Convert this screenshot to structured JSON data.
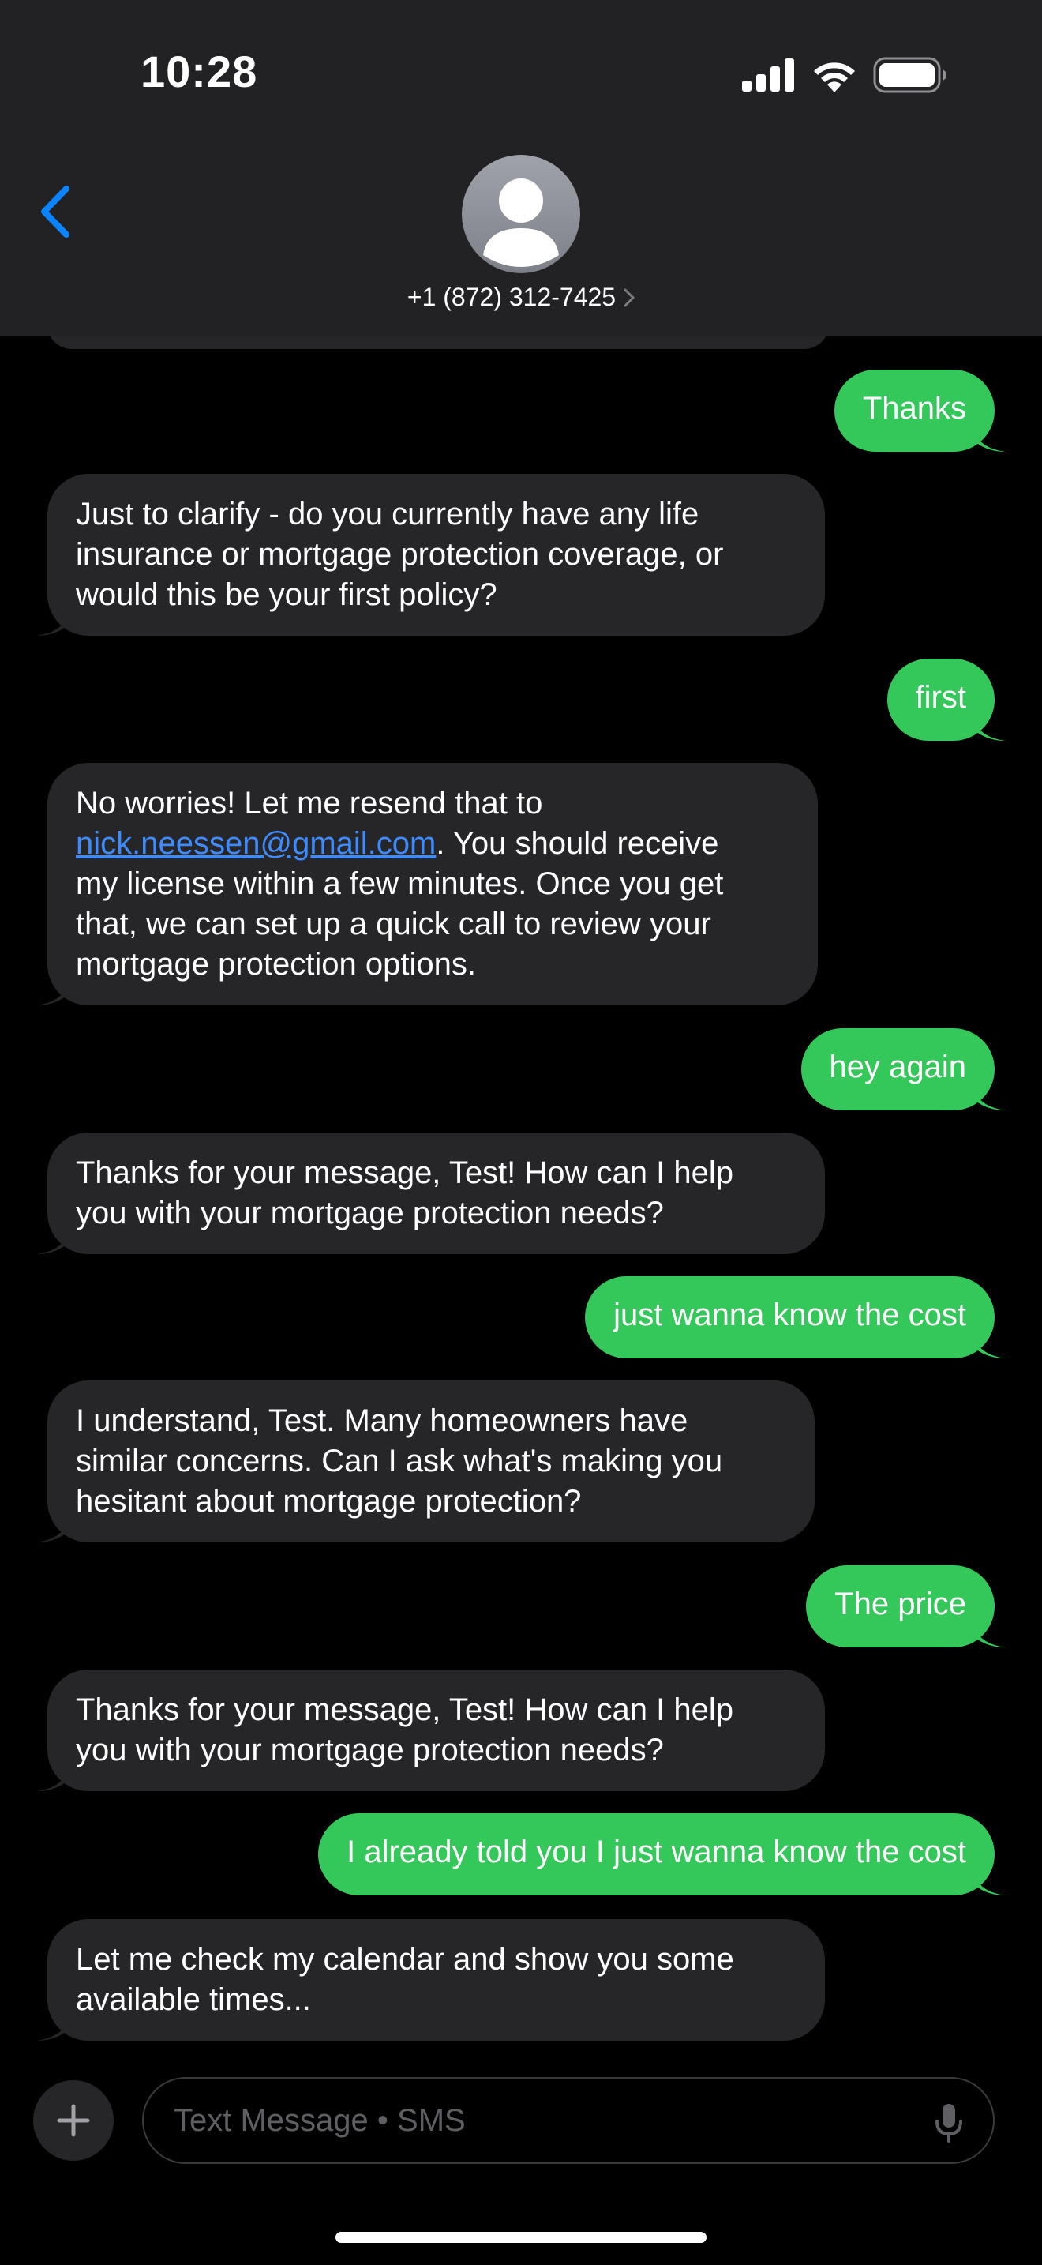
{
  "status_bar": {
    "time": "10:28"
  },
  "header": {
    "contact": "+1 (872) 312-7425",
    "back_icon": "chevron-left-icon",
    "avatar_icon": "person-silhouette-icon"
  },
  "messages": [
    {
      "dir": "out",
      "text": "Thanks"
    },
    {
      "dir": "in",
      "lines": [
        "Just to clarify - do you currently have any life",
        "insurance or mortgage protection coverage, or",
        "would this be your first policy?"
      ]
    },
    {
      "dir": "out",
      "text": "first"
    },
    {
      "dir": "in",
      "line1": "No worries! Let me resend that to",
      "email": "nick.neessen@gmail.com",
      "line2_rest": ". You should receive",
      "lines_after": [
        "my license within a few minutes. Once you get",
        "that, we can set up a quick call to review your",
        "mortgage protection options."
      ]
    },
    {
      "dir": "out",
      "text": "hey again"
    },
    {
      "dir": "in",
      "lines": [
        "Thanks for your message, Test! How can I help",
        "you with your mortgage protection needs?"
      ]
    },
    {
      "dir": "out",
      "text": "just wanna know the cost"
    },
    {
      "dir": "in",
      "lines": [
        "I understand, Test. Many homeowners have",
        "similar concerns. Can I ask what's making you",
        "hesitant about mortgage protection?"
      ]
    },
    {
      "dir": "out",
      "text": "The price"
    },
    {
      "dir": "in",
      "lines": [
        "Thanks for your message, Test! How can I help",
        "you with your mortgage protection needs?"
      ]
    },
    {
      "dir": "out",
      "text": "I already told you I just wanna know the cost"
    },
    {
      "dir": "in",
      "lines": [
        "Let me check my calendar and show you some",
        "available times..."
      ]
    }
  ],
  "composer": {
    "placeholder": "Text Message • SMS",
    "plus_icon": "plus-icon",
    "mic_icon": "microphone-icon"
  },
  "colors": {
    "incoming_bubble": "#262629",
    "outgoing_bubble": "#34c759",
    "header_bg": "#222224",
    "link": "#3d8bfd",
    "accent": "#0a84ff"
  }
}
